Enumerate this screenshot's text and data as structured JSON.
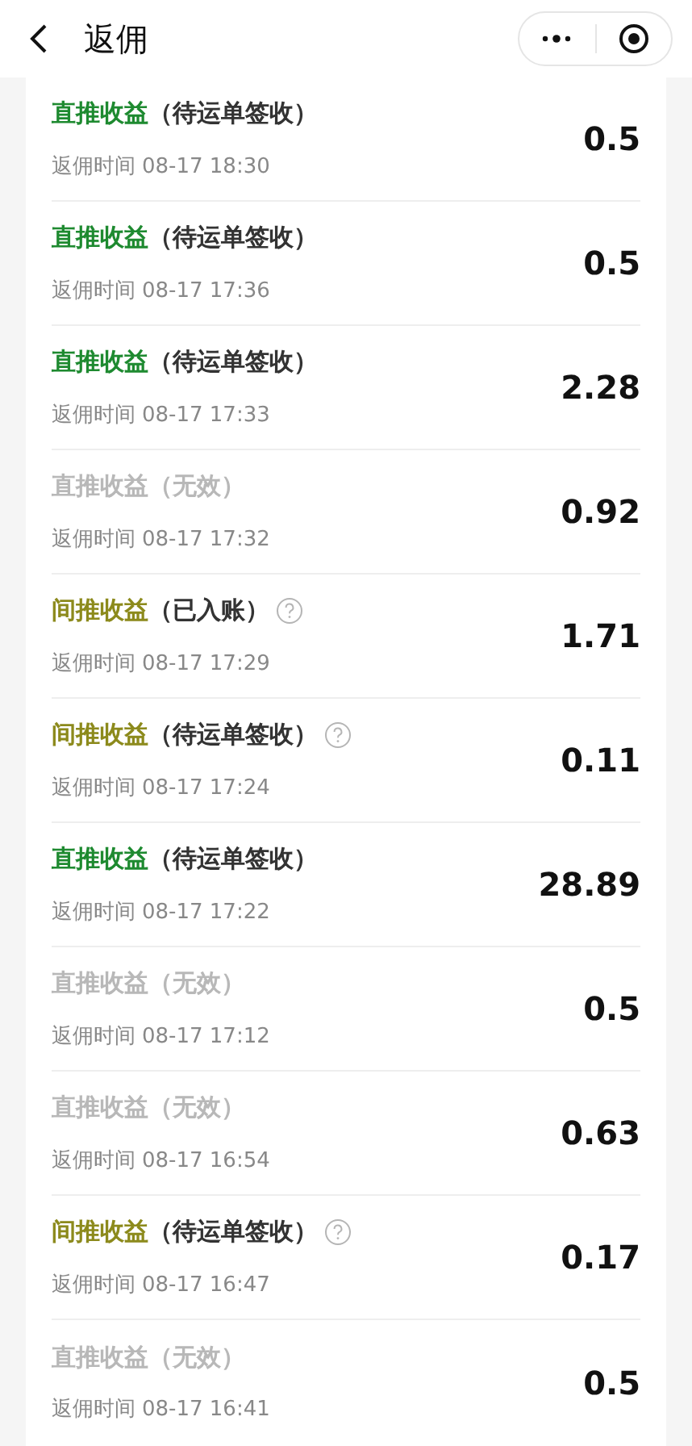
{
  "nav": {
    "title": "返佣"
  },
  "records": [
    {
      "kind": "direct",
      "type": "直推收益",
      "status": "（待运单签收）",
      "help": false,
      "time_label": "返佣时间",
      "time": "08-17 18:30",
      "amount": "0.5"
    },
    {
      "kind": "direct",
      "type": "直推收益",
      "status": "（待运单签收）",
      "help": false,
      "time_label": "返佣时间",
      "time": "08-17 17:36",
      "amount": "0.5"
    },
    {
      "kind": "direct",
      "type": "直推收益",
      "status": "（待运单签收）",
      "help": false,
      "time_label": "返佣时间",
      "time": "08-17 17:33",
      "amount": "2.28"
    },
    {
      "kind": "invalid",
      "type": "直推收益",
      "status": "（无效）",
      "help": false,
      "time_label": "返佣时间",
      "time": "08-17 17:32",
      "amount": "0.92"
    },
    {
      "kind": "indirect",
      "type": "间推收益",
      "status": "（已入账）",
      "help": true,
      "time_label": "返佣时间",
      "time": "08-17 17:29",
      "amount": "1.71"
    },
    {
      "kind": "indirect",
      "type": "间推收益",
      "status": "（待运单签收）",
      "help": true,
      "time_label": "返佣时间",
      "time": "08-17 17:24",
      "amount": "0.11"
    },
    {
      "kind": "direct",
      "type": "直推收益",
      "status": "（待运单签收）",
      "help": false,
      "time_label": "返佣时间",
      "time": "08-17 17:22",
      "amount": "28.89"
    },
    {
      "kind": "invalid",
      "type": "直推收益",
      "status": "（无效）",
      "help": false,
      "time_label": "返佣时间",
      "time": "08-17 17:12",
      "amount": "0.5"
    },
    {
      "kind": "invalid",
      "type": "直推收益",
      "status": "（无效）",
      "help": false,
      "time_label": "返佣时间",
      "time": "08-17 16:54",
      "amount": "0.63"
    },
    {
      "kind": "indirect",
      "type": "间推收益",
      "status": "（待运单签收）",
      "help": true,
      "time_label": "返佣时间",
      "time": "08-17 16:47",
      "amount": "0.17"
    },
    {
      "kind": "invalid",
      "type": "直推收益",
      "status": "（无效）",
      "help": false,
      "time_label": "返佣时间",
      "time": "08-17 16:41",
      "amount": "0.5"
    }
  ]
}
